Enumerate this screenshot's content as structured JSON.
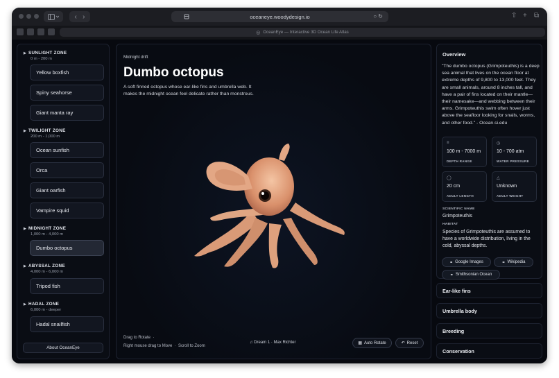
{
  "browser": {
    "url": "oceaneye.woodydesign.io",
    "tab_title": "OceanEye — Interactive 3D Ocean Life Atlas"
  },
  "sidebar": {
    "zones": [
      {
        "name": "SUNLIGHT ZONE",
        "range": "0 m - 200 m",
        "species": [
          "Yellow boxfish",
          "Spiny seahorse",
          "Giant manta ray"
        ]
      },
      {
        "name": "TWILIGHT ZONE",
        "range": "200 m - 1,000 m",
        "species": [
          "Ocean sunfish",
          "Orca",
          "Giant oarfish",
          "Vampire squid"
        ]
      },
      {
        "name": "MIDNIGHT ZONE",
        "range": "1,000 m - 4,000 m",
        "species": [
          "Dumbo octopus"
        ]
      },
      {
        "name": "ABYSSAL ZONE",
        "range": "4,000 m - 6,000 m",
        "species": [
          "Tripod fish"
        ]
      },
      {
        "name": "HADAL ZONE",
        "range": "6,000 m - deeper",
        "species": [
          "Hadal snailfish"
        ]
      }
    ],
    "active_species": "Dumbo octopus",
    "about_label": "About OceanEye"
  },
  "stage": {
    "kicker": "Midnight drift",
    "title": "Dumbo octopus",
    "description": "A soft finned octopus whose ear-like fins and umbrella web. It makes the midnight ocean feel delicate rather than monstrous.",
    "hint_rotate": "Drag to Rotate",
    "hint_move": "Right mouse drag to Move",
    "hint_zoom": "Scroll to Zoom",
    "music": "Dream 1 · Max Richter",
    "auto_rotate_label": "Auto Rotate",
    "reset_label": "Reset"
  },
  "overview": {
    "heading": "Overview",
    "quote": "\"The dumbo octopus (Grimpoteuthis) is a deep sea animal that lives on the ocean floor at extreme depths of 9,800 to 13,000 feet. They are small animals, around 8 inches tall, and have a pair of fins located on their mantle—their namesake—and webbing between their arms. Grimpoteuthis swim often hover just above the seafloor looking for snails, worms, and other food.\" - Ocean.si.edu",
    "stats": [
      {
        "icon": "ruler-icon",
        "value": "100 m - 7000 m",
        "label": "DEPTH RANGE"
      },
      {
        "icon": "gauge-icon",
        "value": "10 - 700 atm",
        "label": "WATER PRESSURE"
      },
      {
        "icon": "tag-icon",
        "value": "20 cm",
        "label": "ADULT LENGTH"
      },
      {
        "icon": "weight-icon",
        "value": "Unknown",
        "label": "ADULT WEIGHT"
      }
    ],
    "scientific_name_label": "SCIENTIFIC NAME",
    "scientific_name": "Grimpoteuthis",
    "habitat_label": "HABITAT",
    "habitat": "Species of Grimpoteuthis are assumed to have a worldwide distribution, living in the cold, abyssal depths.",
    "links": [
      "Google Images",
      "Wikipedia",
      "Smithsonian Ocean"
    ]
  },
  "accordion": [
    "Ear-like fins",
    "Umbrella body",
    "Breeding",
    "Conservation"
  ]
}
